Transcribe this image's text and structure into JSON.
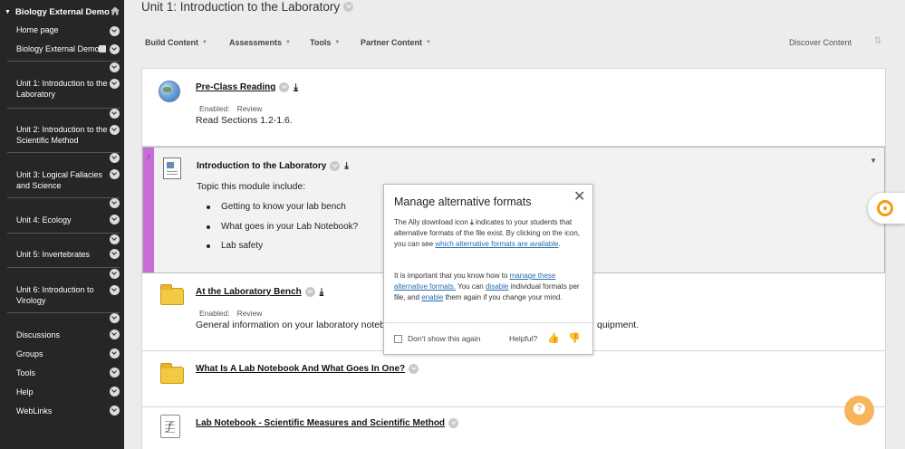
{
  "sidebar": {
    "course_title": "Biology External Demo",
    "home_icon": "home-icon",
    "items": [
      {
        "label": "Home page"
      },
      {
        "label": "Biology External Demo"
      },
      {
        "label": "Unit 1: Introduction to the Laboratory"
      },
      {
        "label": "Unit 2: Introduction to the Scientific Method"
      },
      {
        "label": "Unit 3: Logical Fallacies and Science"
      },
      {
        "label": "Unit 4: Ecology"
      },
      {
        "label": "Unit 5: Invertebrates"
      },
      {
        "label": "Unit 6: Introduction to Virology"
      },
      {
        "label": "Discussions"
      },
      {
        "label": "Groups"
      },
      {
        "label": "Tools"
      },
      {
        "label": "Help"
      },
      {
        "label": "WebLinks"
      }
    ]
  },
  "page": {
    "title": "Unit 1: Introduction to the Laboratory"
  },
  "toolbar": {
    "build_content": "Build Content",
    "assessments": "Assessments",
    "tools": "Tools",
    "partner_content": "Partner Content",
    "discover_content": "Discover Content"
  },
  "items": [
    {
      "title": "Pre-Class Reading",
      "enabled": "Enabled:",
      "status": "Review",
      "description": "Read Sections 1.2-1.6."
    },
    {
      "title": "Introduction to the Laboratory",
      "description": "Topic this module include:",
      "bullets": [
        "Getting to know your lab bench",
        "What goes in your Lab Notebook?",
        "Lab safety"
      ]
    },
    {
      "title": "At the Laboratory Bench",
      "enabled": "Enabled:",
      "status": "Review",
      "description": "General information on your laboratory noteb",
      "description_tail": "quipment."
    },
    {
      "title": "What Is A Lab Notebook And What Goes In One?"
    },
    {
      "title": "Lab Notebook - Scientific Measures and Scientific Method"
    }
  ],
  "popover": {
    "title": "Manage alternative formats",
    "p1_a": "The Ally download icon",
    "p1_b": "indicates to your students that alternative formats of the file exist. By clicking on the icon, you can see",
    "p1_link": "which alternative formats are available",
    "p2_a": "It is important that you know how to",
    "p2_link1": "manage these alternative formats.",
    "p2_b": "You can",
    "p2_link2": "disable",
    "p2_c": "individual formats per file, and",
    "p2_link3": "enable",
    "p2_d": "them again if you change your mind.",
    "dont_show": "Don't show this again",
    "helpful": "Helpful?"
  },
  "colors": {
    "sidebar_bg": "#262626",
    "selected_bar": "#c56cd6",
    "link": "#2b6cb0",
    "help_button": "#f6b55a",
    "ally_orange": "#f39c12"
  }
}
